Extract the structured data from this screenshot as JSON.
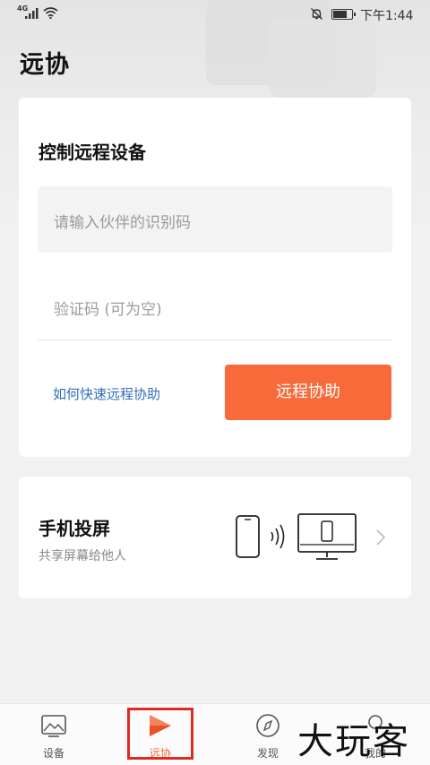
{
  "status_bar": {
    "network": "4G",
    "time": "下午1:44",
    "battery_percent": 80
  },
  "page": {
    "title": "远协"
  },
  "remote_control": {
    "title": "控制远程设备",
    "partner_id_placeholder": "请输入伙伴的识别码",
    "code_placeholder": "验证码 (可为空)",
    "help_link": "如何快速远程协助",
    "assist_button": "远程协助"
  },
  "screen_cast": {
    "title": "手机投屏",
    "subtitle": "共享屏幕给他人"
  },
  "tabs": [
    {
      "label": "设备",
      "icon": "image-icon",
      "active": false
    },
    {
      "label": "远协",
      "icon": "remote-assist-icon",
      "active": true
    },
    {
      "label": "发现",
      "icon": "compass-icon",
      "active": false
    },
    {
      "label": "我的",
      "icon": "person-icon",
      "active": false
    }
  ],
  "watermark": "大玩客",
  "colors": {
    "accent": "#f86a3a",
    "link": "#2f6fb8",
    "highlight_box": "#e02a1f"
  }
}
